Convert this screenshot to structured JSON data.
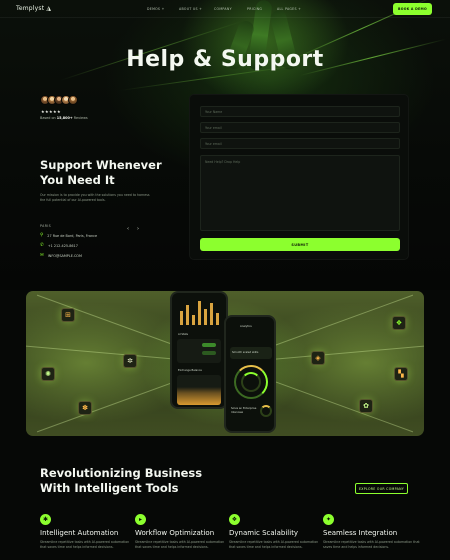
{
  "nav": {
    "logo": "Templyst ◮",
    "links": [
      "DEMOS +",
      "ABOUT US +",
      "COMPANY",
      "PRICING",
      "ALL PAGES +"
    ],
    "cta": "BOOK A DEMO"
  },
  "hero": {
    "title": "Help & Support",
    "stars": "★★★★★",
    "reviews_prefix": "Based on ",
    "reviews_count": "15,800+",
    "reviews_suffix": " Reviews"
  },
  "support": {
    "heading_line1": "Support Whenever",
    "heading_line2": "You Need It",
    "paragraph": "Our mission is to provide you with the solutions you need to harness the full potential of our AI-powered tools.",
    "prev_arrow": "‹",
    "next_arrow": "›",
    "city": "PARIS",
    "address": "27 Rue de Bord, Paris, France",
    "phone": "+1 212-425-8617",
    "email": "INFO@SAMPLE.COM"
  },
  "form": {
    "name_placeholder": "Your Name",
    "email_placeholder": "Your email",
    "subject_placeholder": "Your email",
    "message_placeholder": "Need Help? Drop Help",
    "submit": "SUBMIT"
  },
  "showcase": {
    "phone_left_label": "AI Stats",
    "phone_right_label": "Analytics",
    "phone_right_heading": "Smooth scaled skills",
    "phone_right_sub": "Solve an Enterprise Interview",
    "phone_card_label": "Exchange Balance"
  },
  "revolution": {
    "heading_line1": "Revolutionizing Business",
    "heading_line2": "With Intelligent Tools",
    "cta": "EXPLORE OUR COMPANY"
  },
  "features": [
    {
      "title": "Intelligent Automation",
      "desc": "Streamline repetitive tasks with AI-powered automation that saves time and helps informed decisions.",
      "icon": "✱"
    },
    {
      "title": "Workflow Optimization",
      "desc": "Streamline repetitive tasks with AI-powered automation that saves time and helps informed decisions.",
      "icon": "▸"
    },
    {
      "title": "Dynamic Scalability",
      "desc": "Streamline repetitive tasks with AI-powered automation that saves time and helps informed decisions.",
      "icon": "❖"
    },
    {
      "title": "Seamless Integration",
      "desc": "Streamline repetitive tasks with AI-powered automation that saves time and helps informed decisions.",
      "icon": "✦"
    }
  ],
  "colors": {
    "accent": "#8cff2e",
    "background": "#060806"
  }
}
